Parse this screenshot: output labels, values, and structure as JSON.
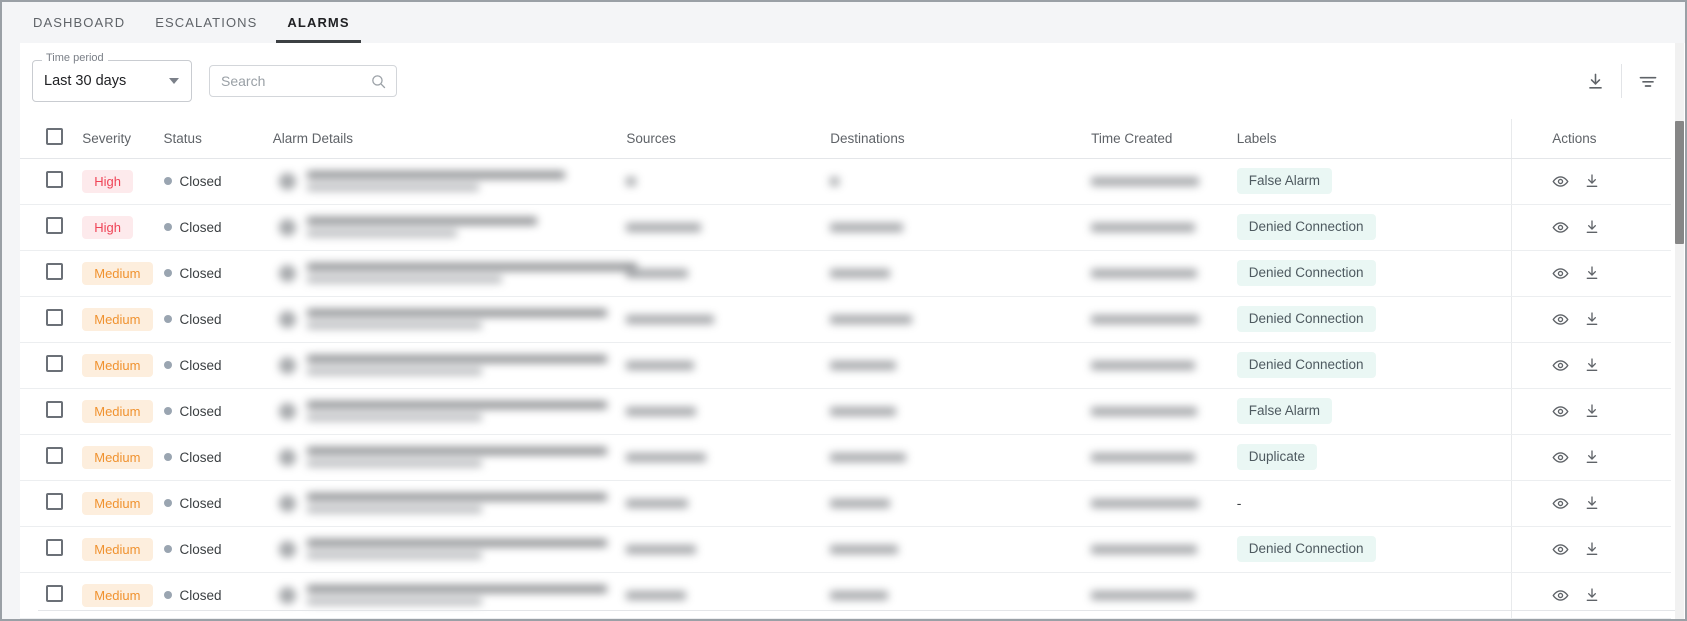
{
  "nav": {
    "tabs": [
      {
        "label": "DASHBOARD",
        "active": false
      },
      {
        "label": "ESCALATIONS",
        "active": false
      },
      {
        "label": "ALARMS",
        "active": true
      }
    ]
  },
  "toolbar": {
    "time_period_label": "Time period",
    "time_period_value": "Last 30 days",
    "search_placeholder": "Search",
    "search_value": "",
    "download_icon": "download-icon",
    "filter_icon": "filter-icon"
  },
  "table": {
    "columns": [
      "Severity",
      "Status",
      "Alarm Details",
      "Sources",
      "Destinations",
      "Time Created",
      "Labels",
      "Actions"
    ],
    "row_action_icons": [
      "eye-icon",
      "download-icon"
    ],
    "rows": [
      {
        "severity": "High",
        "status": "Closed",
        "label": "False Alarm",
        "redacted": true
      },
      {
        "severity": "High",
        "status": "Closed",
        "label": "Denied Connection",
        "redacted": true
      },
      {
        "severity": "Medium",
        "status": "Closed",
        "label": "Denied Connection",
        "redacted": true
      },
      {
        "severity": "Medium",
        "status": "Closed",
        "label": "Denied Connection",
        "redacted": true
      },
      {
        "severity": "Medium",
        "status": "Closed",
        "label": "Denied Connection",
        "redacted": true
      },
      {
        "severity": "Medium",
        "status": "Closed",
        "label": "False Alarm",
        "redacted": true
      },
      {
        "severity": "Medium",
        "status": "Closed",
        "label": "Duplicate",
        "redacted": true
      },
      {
        "severity": "Medium",
        "status": "Closed",
        "label": "-",
        "redacted": true
      },
      {
        "severity": "Medium",
        "status": "Closed",
        "label": "Denied Connection",
        "redacted": true
      },
      {
        "severity": "Medium",
        "status": "Closed",
        "label": "",
        "redacted": true
      }
    ]
  },
  "colors": {
    "severity_high_bg": "#fdeaec",
    "severity_high_text": "#ef4457",
    "severity_medium_bg": "#fdeedd",
    "severity_medium_text": "#f0922f",
    "label_chip_bg": "#eaf7f4",
    "status_dot": "#9aa5b1",
    "active_tab_underline": "#3c4043",
    "page_bg": "#f4f5f7"
  }
}
